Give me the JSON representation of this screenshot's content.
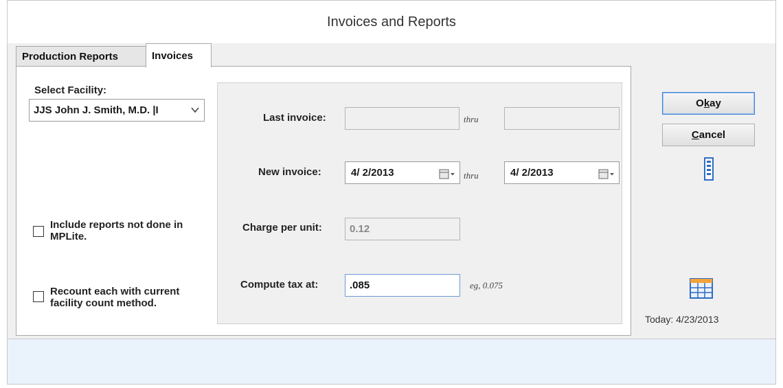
{
  "window": {
    "title": "Invoices and Reports"
  },
  "tabs": [
    {
      "label": "Production Reports",
      "selected": false
    },
    {
      "label": "Invoices",
      "selected": true
    }
  ],
  "facility": {
    "label": "Select Facility:",
    "selected_value": "JJS  John J. Smith, M.D. |I"
  },
  "options": {
    "include_reports": {
      "label_line1": "Include reports not done in",
      "label_line2": "MPLite.",
      "checked": false
    },
    "recount": {
      "label_line1": "Recount each with current",
      "label_line2": "facility count method.",
      "checked": false
    }
  },
  "invoice": {
    "last_label": "Last invoice:",
    "last_from": "",
    "last_to": "",
    "thru": "thru",
    "new_label": "New invoice:",
    "new_from": "4/  2/2013",
    "new_to": "4/  2/2013",
    "charge_label": "Charge per unit:",
    "charge_value": "0.12",
    "tax_label": "Compute tax at:",
    "tax_value": ".085",
    "tax_example": "eg, 0.075"
  },
  "buttons": {
    "okay": {
      "pre": "O",
      "accel": "k",
      "post": "ay"
    },
    "cancel": {
      "accel": "C",
      "post": "ancel"
    }
  },
  "status": {
    "today": "Today: 4/23/2013"
  },
  "colors": {
    "accent": "#3c7fd6",
    "bottom_pane": "#eaf2fb"
  }
}
